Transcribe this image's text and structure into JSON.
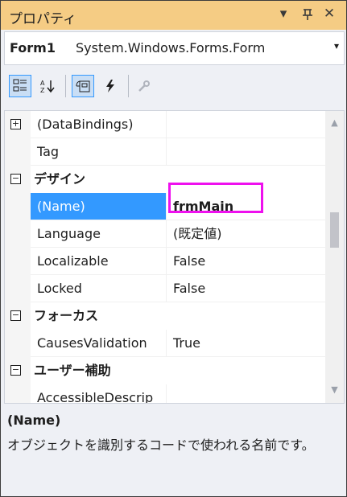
{
  "window": {
    "title": "プロパティ",
    "dropdown_icon": "▾",
    "pin_icon": "ꟷ",
    "close_icon": "✕"
  },
  "object_selector": {
    "name": "Form1",
    "type": "System.Windows.Forms.Form",
    "dropdown_icon": "▾"
  },
  "toolbar": {
    "categorized_icon": "▦",
    "alphabetical_icon": "A↓",
    "properties_icon": "⊡",
    "events_icon": "ϟ",
    "property_pages_icon": "🔧"
  },
  "grid": {
    "rows": [
      {
        "kind": "prop",
        "expander": "⊞",
        "name": "(DataBindings)",
        "value": ""
      },
      {
        "kind": "prop",
        "expander": "",
        "name": "Tag",
        "value": ""
      },
      {
        "kind": "cat",
        "expander": "⊟",
        "name": "デザイン"
      },
      {
        "kind": "prop",
        "expander": "",
        "name": "(Name)",
        "value": "frmMain",
        "selected": true,
        "bold": true
      },
      {
        "kind": "prop",
        "expander": "",
        "name": "Language",
        "value": "(既定値)"
      },
      {
        "kind": "prop",
        "expander": "",
        "name": "Localizable",
        "value": "False"
      },
      {
        "kind": "prop",
        "expander": "",
        "name": "Locked",
        "value": "False"
      },
      {
        "kind": "cat",
        "expander": "⊟",
        "name": "フォーカス"
      },
      {
        "kind": "prop",
        "expander": "",
        "name": "CausesValidation",
        "value": "True"
      },
      {
        "kind": "cat",
        "expander": "⊟",
        "name": "ユーザー補助"
      },
      {
        "kind": "prop",
        "expander": "",
        "name": "AccessibleDescrip",
        "value": ""
      }
    ]
  },
  "description": {
    "title": "(Name)",
    "text": "オブジェクトを識別するコードで使われる名前です。"
  },
  "colors": {
    "title_bar": "#f5cc84",
    "selection": "#3399ff",
    "highlight_box": "#ee10ee"
  }
}
